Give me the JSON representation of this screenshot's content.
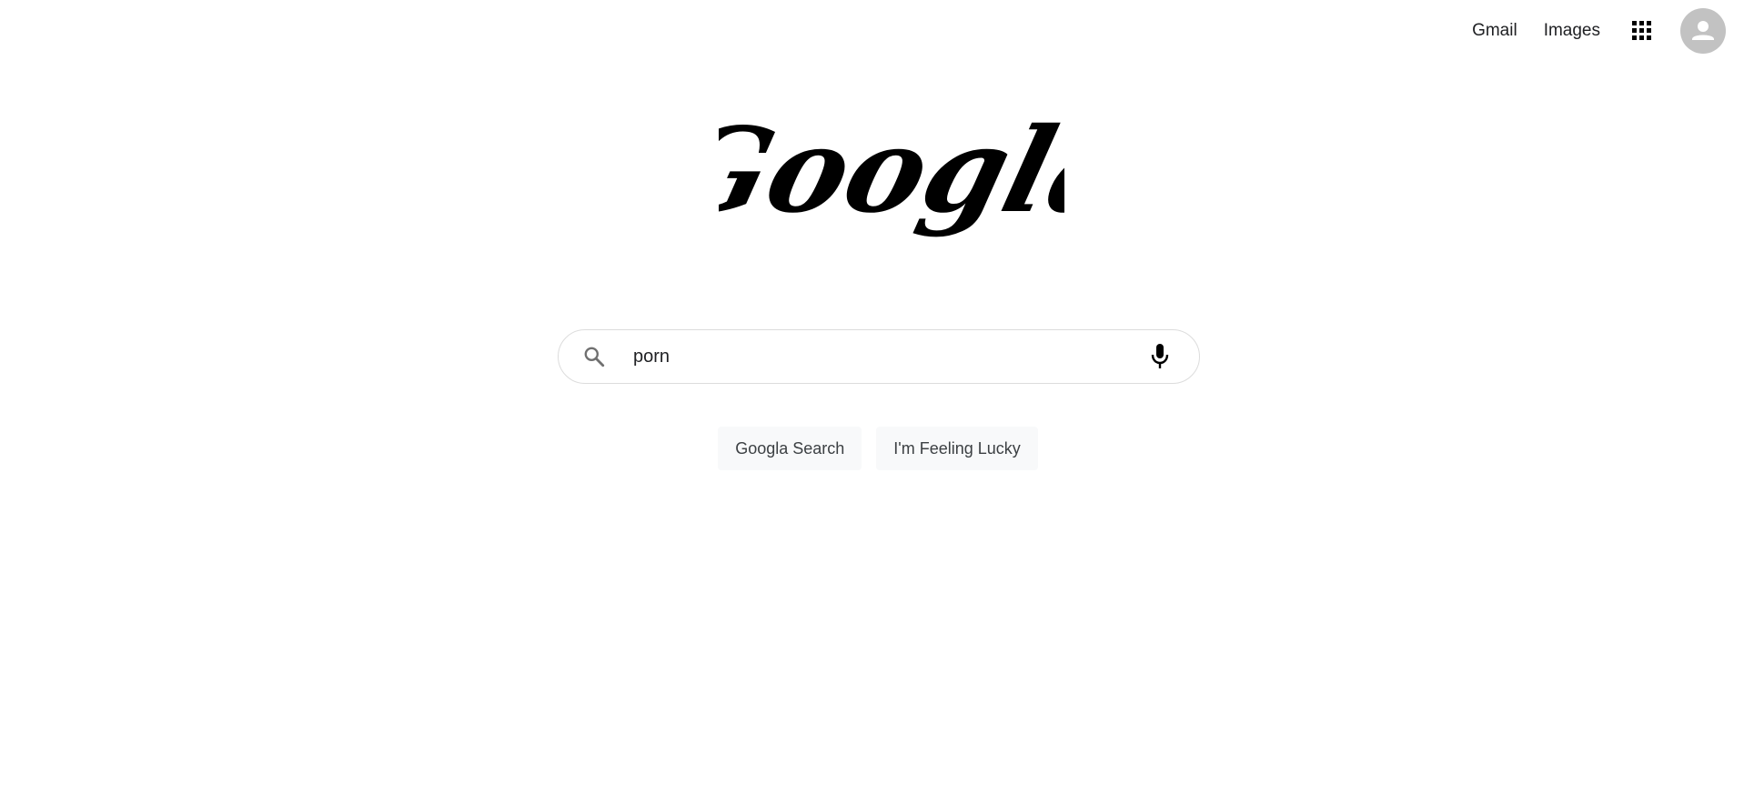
{
  "header": {
    "gmail_label": "Gmail",
    "images_label": "Images",
    "apps_icon": "apps-grid-icon",
    "avatar_icon": "account-icon"
  },
  "logo": {
    "text": "Googla"
  },
  "search": {
    "value": "porn",
    "placeholder": "",
    "search_icon": "search-icon",
    "mic_icon": "microphone-icon"
  },
  "buttons": {
    "search_label": "Googla Search",
    "lucky_label": "I'm Feeling Lucky"
  },
  "colors": {
    "text": "#202124",
    "button_bg": "#f8f9fa",
    "button_text": "#3c4043",
    "border": "#dcdcdc",
    "avatar_bg": "#c2c2c2"
  }
}
